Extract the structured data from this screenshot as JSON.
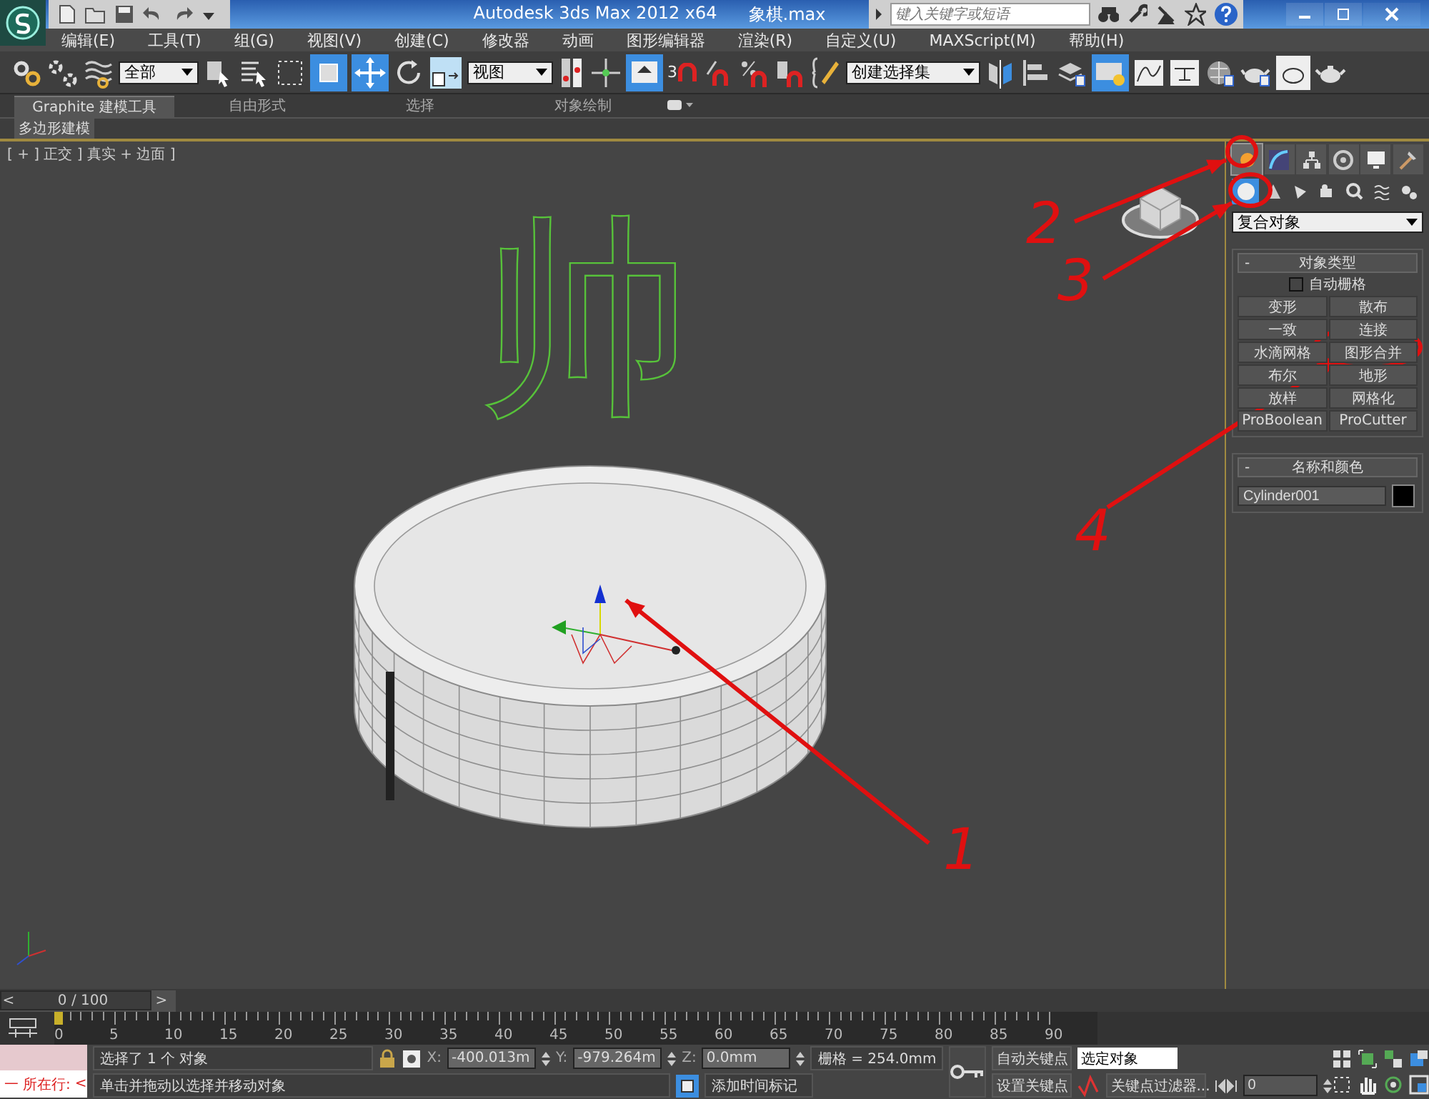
{
  "title_bar": {
    "app_title": "Autodesk 3ds Max  2012 x64",
    "file_name": "象棋.max",
    "search": {
      "placeholder": "键入关键字或短语"
    }
  },
  "menu": [
    "编辑(E)",
    "工具(T)",
    "组(G)",
    "视图(V)",
    "创建(C)",
    "修改器",
    "动画",
    "图形编辑器",
    "渲染(R)",
    "自定义(U)",
    "MAXScript(M)",
    "帮助(H)"
  ],
  "toolbar": {
    "selection_filter": "全部",
    "reference_coord": "视图",
    "snap_count": "3",
    "named_selection": "创建选择集"
  },
  "ribbon": {
    "tabs": [
      {
        "label": "Graphite 建模工具",
        "selected": true
      },
      {
        "label": "自由形式",
        "selected": false
      },
      {
        "label": "选择",
        "selected": false
      },
      {
        "label": "对象绘制",
        "selected": false
      }
    ],
    "panel": "多边形建模"
  },
  "viewport": {
    "label": "[ + ] 正交 ] 真实 + 边面 ]",
    "scene_text": "帅",
    "annotations": [
      "1",
      "2",
      "3",
      "4"
    ]
  },
  "command_panel": {
    "tabs": [
      {
        "selected": true
      },
      {
        "selected": false
      },
      {
        "selected": false
      },
      {
        "selected": false
      },
      {
        "selected": false
      },
      {
        "selected": false
      }
    ],
    "subtabs": [
      {
        "selected": true
      },
      {
        "selected": false
      },
      {
        "selected": false
      },
      {
        "selected": false
      },
      {
        "selected": false
      },
      {
        "selected": false
      },
      {
        "selected": false
      }
    ],
    "category": "复合对象",
    "object_type": {
      "title": "对象类型",
      "collapse_mark": "-",
      "autogrid": {
        "label": "自动栅格",
        "checked": false
      },
      "buttons": [
        "变形",
        "散布",
        "一致",
        "连接",
        "水滴网格",
        "图形合并",
        "布尔",
        "地形",
        "放样",
        "网格化",
        "ProBoolean",
        "ProCutter"
      ]
    },
    "name_color": {
      "title": "名称和颜色",
      "collapse_mark": "-",
      "name": "Cylinder001",
      "color": "#000000"
    }
  },
  "timeline": {
    "frame": "0 / 100",
    "prev": "<",
    "next": ">",
    "level": 0,
    "ticks": [
      "0",
      "5",
      "10",
      "15",
      "20",
      "25",
      "30",
      "35",
      "40",
      "45",
      "50",
      "55",
      "60",
      "65",
      "70",
      "75",
      "80",
      "85",
      "90"
    ]
  },
  "status": {
    "listener_mark": "一",
    "listener_label": "所在行:",
    "listener_arrow": "<",
    "selection_info": "选择了 1 个 对象",
    "prompt": "单击并拖动以选择并移动对象",
    "coords": [
      {
        "label": "X:",
        "value": "-400.013m"
      },
      {
        "label": "Y:",
        "value": "-979.264m"
      },
      {
        "label": "Z:",
        "value": "0.0mm"
      }
    ],
    "grid": "栅格 = 254.0mm",
    "add_time_tag": "添加时间标记",
    "auto_key": "自动关键点",
    "key_mode": "选定对象",
    "set_key": "设置关键点",
    "key_filters": "关键点过滤器...",
    "current_frame": "0"
  }
}
